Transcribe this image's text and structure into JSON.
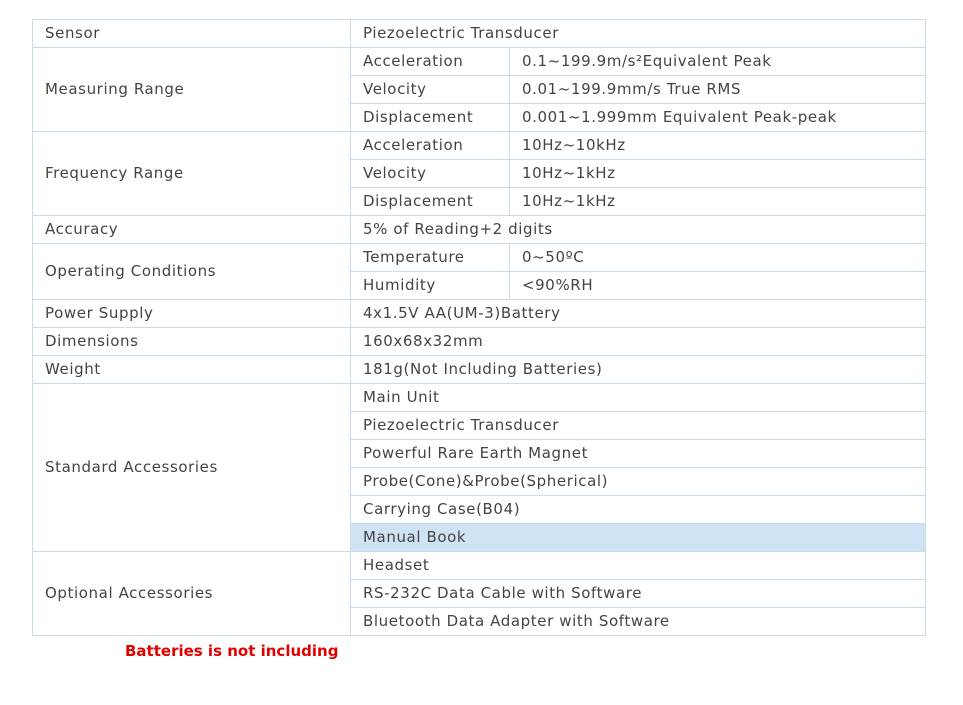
{
  "spec_table": {
    "sensor": {
      "label": "Sensor",
      "value": "Piezoelectric Transducer"
    },
    "measuring_range": {
      "label": "Measuring Range",
      "rows": [
        {
          "sub": "Acceleration",
          "value": "0.1~199.9m/s²Equivalent Peak"
        },
        {
          "sub": "Velocity",
          "value": "0.01~199.9mm/s True RMS"
        },
        {
          "sub": "Displacement",
          "value": "0.001~1.999mm Equivalent Peak-peak"
        }
      ]
    },
    "frequency_range": {
      "label": "Frequency Range",
      "rows": [
        {
          "sub": "Acceleration",
          "value": "10Hz~10kHz"
        },
        {
          "sub": "Velocity",
          "value": "10Hz~1kHz"
        },
        {
          "sub": "Displacement",
          "value": "10Hz~1kHz"
        }
      ]
    },
    "accuracy": {
      "label": "Accuracy",
      "value": "5% of Reading+2 digits"
    },
    "operating_conditions": {
      "label": "Operating Conditions",
      "rows": [
        {
          "sub": "Temperature",
          "value": "0~50ºC"
        },
        {
          "sub": "Humidity",
          "value": "<90%RH"
        }
      ]
    },
    "power_supply": {
      "label": "Power Supply",
      "value": "4x1.5V AA(UM-3)Battery"
    },
    "dimensions": {
      "label": "Dimensions",
      "value": "160x68x32mm"
    },
    "weight": {
      "label": "Weight",
      "value": "181g(Not Including Batteries)"
    },
    "standard_accessories": {
      "label": "Standard Accessories",
      "items": [
        "Main Unit",
        "Piezoelectric Transducer",
        "Powerful Rare Earth Magnet",
        "Probe(Cone)&Probe(Spherical)",
        "Carrying Case(B04)",
        "Manual Book"
      ]
    },
    "optional_accessories": {
      "label": "Optional Accessories",
      "items": [
        "Headset",
        "RS-232C Data Cable with Software",
        "Bluetooth Data Adapter with Software"
      ]
    }
  },
  "note": "Batteries is not including",
  "colors": {
    "border": "#c8dcec",
    "text": "#444444",
    "highlight_row": "#cfe3f5",
    "note_text": "#e00000"
  }
}
